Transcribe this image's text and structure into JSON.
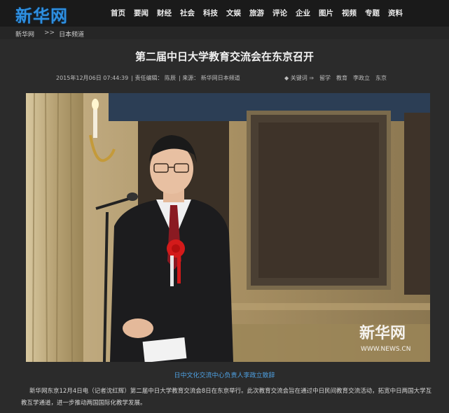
{
  "logo": {
    "text": "新华网"
  },
  "nav": {
    "items": [
      "首页",
      "要闻",
      "财经",
      "社会",
      "科技",
      "文娱",
      "旅游",
      "评论",
      "企业",
      "图片",
      "视频",
      "专题",
      "资料"
    ]
  },
  "breadcrumb": {
    "home": "新华网",
    "separator": ">>",
    "section": "日本频道"
  },
  "article": {
    "title": "第二届中日大学教育交流会在东京召开",
    "datetime": "2015年12月06日 07:44:39",
    "editor": "| 责任编辑： 陈辰",
    "source": "| 来源： 新华网日本频道",
    "keywords_label": "◆ 关键词 ⇒",
    "keywords": [
      "留学",
      "教育",
      "李政立",
      "东京"
    ],
    "caption": "日中文化交流中心负责人李政立致辞",
    "paragraph": "新华网东京12月4日电（记者沈红辉）第二届中日大学教育交流会8日在东京举行。此次教育交流会旨在通过中日民间教育交流活动，拓宽中日两国大学互教互学通道，进一步推动两国国际化教学发展。"
  },
  "watermark": {
    "text": "新华网",
    "url": "WWW.NEWS.CN"
  },
  "colors": {
    "background": "#2b2b2b",
    "topbar": "#1a1a1a",
    "logo": "#2e8fe0",
    "caption": "#4fa3e6"
  }
}
